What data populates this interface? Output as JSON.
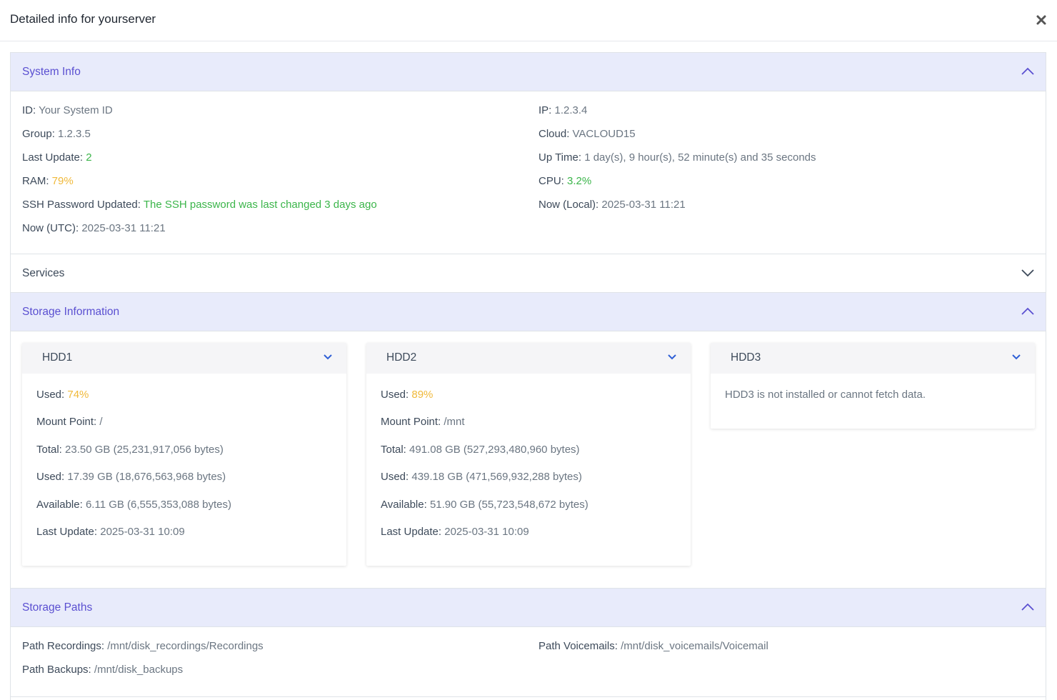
{
  "modal": {
    "title": "Detailed info for yourserver",
    "close_icon": "close-icon"
  },
  "system_info": {
    "title": "System Info",
    "left": [
      {
        "label": "ID:",
        "value": "Your System ID"
      },
      {
        "label": "Group:",
        "value": "1.2.3.5"
      },
      {
        "label": "Last Update:",
        "value": "2"
      },
      {
        "label": "RAM:",
        "value": "79%"
      },
      {
        "label": "SSH Password Updated:",
        "value": "The SSH password was last changed 3 days ago"
      },
      {
        "label": "Now (UTC):",
        "value": "2025-03-31 11:21"
      }
    ],
    "right": [
      {
        "label": "IP:",
        "value": "1.2.3.4"
      },
      {
        "label": "Cloud:",
        "value": "VACLOUD15"
      },
      {
        "label": "Up Time:",
        "value": "1 day(s), 9 hour(s), 52 minute(s) and 35 seconds"
      },
      {
        "label": "CPU:",
        "value": "3.2%"
      },
      {
        "label": "Now (Local):",
        "value": "2025-03-31 11:21"
      }
    ]
  },
  "services": {
    "title": "Services"
  },
  "storage": {
    "title": "Storage Information",
    "hdd1": {
      "title": "HDD1",
      "used_pct_label": "Used:",
      "used_pct": "74%",
      "mount_label": "Mount Point:",
      "mount": "/",
      "total_label": "Total:",
      "total": "23.50 GB (25,231,917,056 bytes)",
      "used_label": "Used:",
      "used": "17.39 GB (18,676,563,968 bytes)",
      "available_label": "Available:",
      "available": "6.11 GB (6,555,353,088 bytes)",
      "last_update_label": "Last Update:",
      "last_update": "2025-03-31 10:09"
    },
    "hdd2": {
      "title": "HDD2",
      "used_pct_label": "Used:",
      "used_pct": "89%",
      "mount_label": "Mount Point:",
      "mount": "/mnt",
      "total_label": "Total:",
      "total": "491.08 GB (527,293,480,960 bytes)",
      "used_label": "Used:",
      "used": "439.18 GB (471,569,932,288 bytes)",
      "available_label": "Available:",
      "available": "51.90 GB (55,723,548,672 bytes)",
      "last_update_label": "Last Update:",
      "last_update": "2025-03-31 10:09"
    },
    "hdd3": {
      "title": "HDD3",
      "message": "HDD3 is not installed or cannot fetch data."
    }
  },
  "storage_paths": {
    "title": "Storage Paths",
    "recordings_label": "Path Recordings:",
    "recordings": "/mnt/disk_recordings/Recordings",
    "voicemails_label": "Path Voicemails:",
    "voicemails": "/mnt/disk_voicemails/Voicemail",
    "backups_label": "Path Backups:",
    "backups": "/mnt/disk_backups"
  },
  "colors": {
    "accent": "#5a4fd1",
    "header_bg": "#e8ebfb",
    "green": "#3bb54a",
    "amber": "#f0b93a",
    "link_blue": "#2f5fd6"
  }
}
